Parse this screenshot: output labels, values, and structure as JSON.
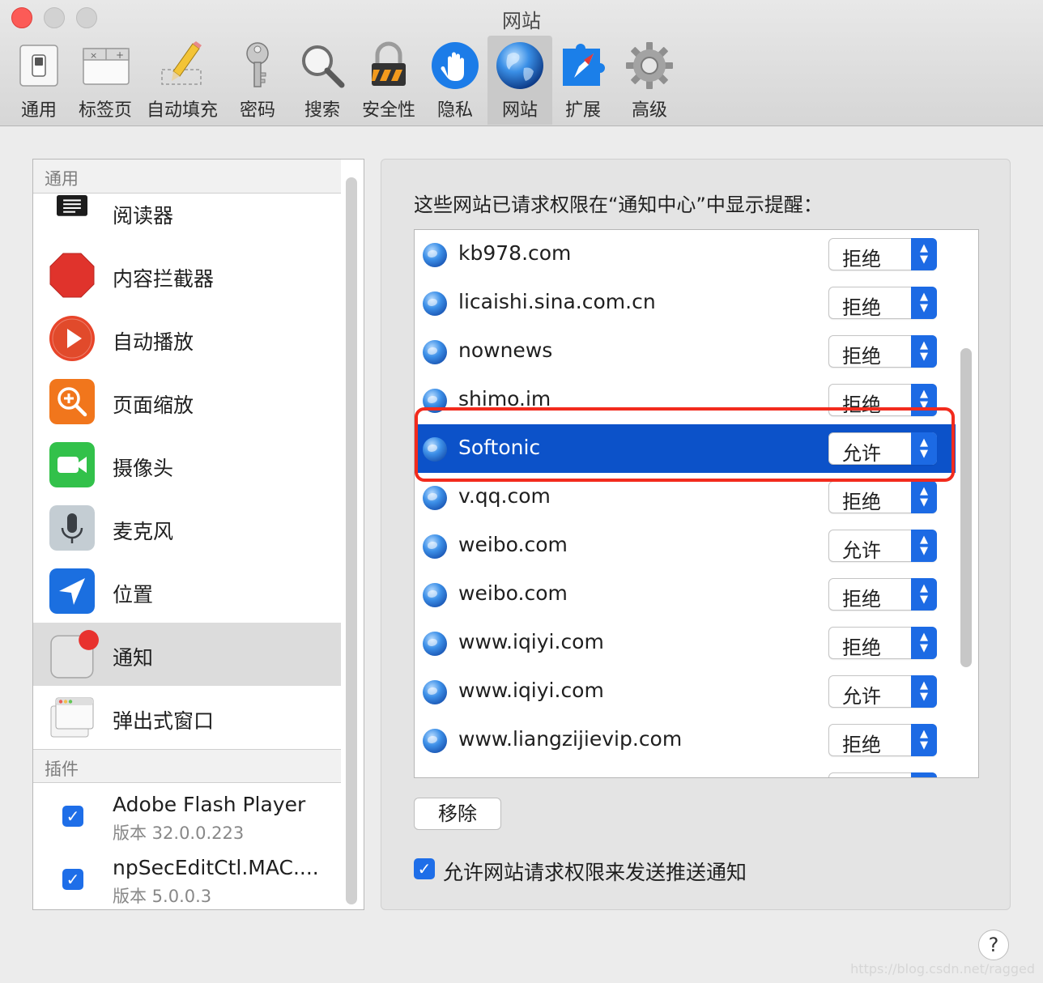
{
  "window": {
    "title": "网站"
  },
  "toolbar": {
    "items": [
      {
        "label": "通用",
        "icon": "general-switch-icon"
      },
      {
        "label": "标签页",
        "icon": "tabs-icon"
      },
      {
        "label": "自动填充",
        "icon": "autofill-pencil-icon"
      },
      {
        "label": "密码",
        "icon": "key-icon"
      },
      {
        "label": "搜索",
        "icon": "magnifier-icon"
      },
      {
        "label": "安全性",
        "icon": "padlock-icon"
      },
      {
        "label": "隐私",
        "icon": "hand-icon"
      },
      {
        "label": "网站",
        "icon": "globe-icon",
        "selected": true
      },
      {
        "label": "扩展",
        "icon": "puzzle-compass-icon"
      },
      {
        "label": "高级",
        "icon": "gear-icon"
      }
    ]
  },
  "sidebar": {
    "general_header": "通用",
    "items": [
      {
        "label": "阅读器",
        "icon": "reader-icon"
      },
      {
        "label": "内容拦截器",
        "icon": "stop-sign-icon"
      },
      {
        "label": "自动播放",
        "icon": "play-icon"
      },
      {
        "label": "页面缩放",
        "icon": "zoom-icon"
      },
      {
        "label": "摄像头",
        "icon": "camera-icon"
      },
      {
        "label": "麦克风",
        "icon": "microphone-icon"
      },
      {
        "label": "位置",
        "icon": "location-arrow-icon"
      },
      {
        "label": "通知",
        "icon": "notification-icon",
        "selected": true
      },
      {
        "label": "弹出式窗口",
        "icon": "popup-window-icon"
      }
    ],
    "plugins_header": "插件",
    "plugins": [
      {
        "name": "Adobe Flash Player",
        "version": "版本 32.0.0.223",
        "checked": true
      },
      {
        "name": "npSecEditCtl.MAC....",
        "version": "版本 5.0.0.3",
        "checked": true
      }
    ]
  },
  "main": {
    "heading": "这些网站已请求权限在“通知中心”中显示提醒：",
    "sites": [
      {
        "name": "kb978.com",
        "permission": "拒绝"
      },
      {
        "name": "licaishi.sina.com.cn",
        "permission": "拒绝"
      },
      {
        "name": "nownews",
        "permission": "拒绝"
      },
      {
        "name": "shimo.im",
        "permission": "拒绝"
      },
      {
        "name": "Softonic",
        "permission": "允许",
        "selected": true
      },
      {
        "name": "v.qq.com",
        "permission": "拒绝"
      },
      {
        "name": "weibo.com",
        "permission": "允许"
      },
      {
        "name": "weibo.com",
        "permission": "拒绝"
      },
      {
        "name": "www.iqiyi.com",
        "permission": "拒绝"
      },
      {
        "name": "www.iqiyi.com",
        "permission": "允许"
      },
      {
        "name": "www.liangzijievip.com",
        "permission": "拒绝"
      }
    ],
    "remove_label": "移除",
    "allow_push_label": "允许网站请求权限来发送推送通知",
    "allow_push_checked": true
  },
  "help_label": "?",
  "watermark": "https://blog.csdn.net/ragged",
  "colors": {
    "accent": "#1c6ae4",
    "selection": "#0c52c9",
    "annotation": "#f22b1d"
  }
}
